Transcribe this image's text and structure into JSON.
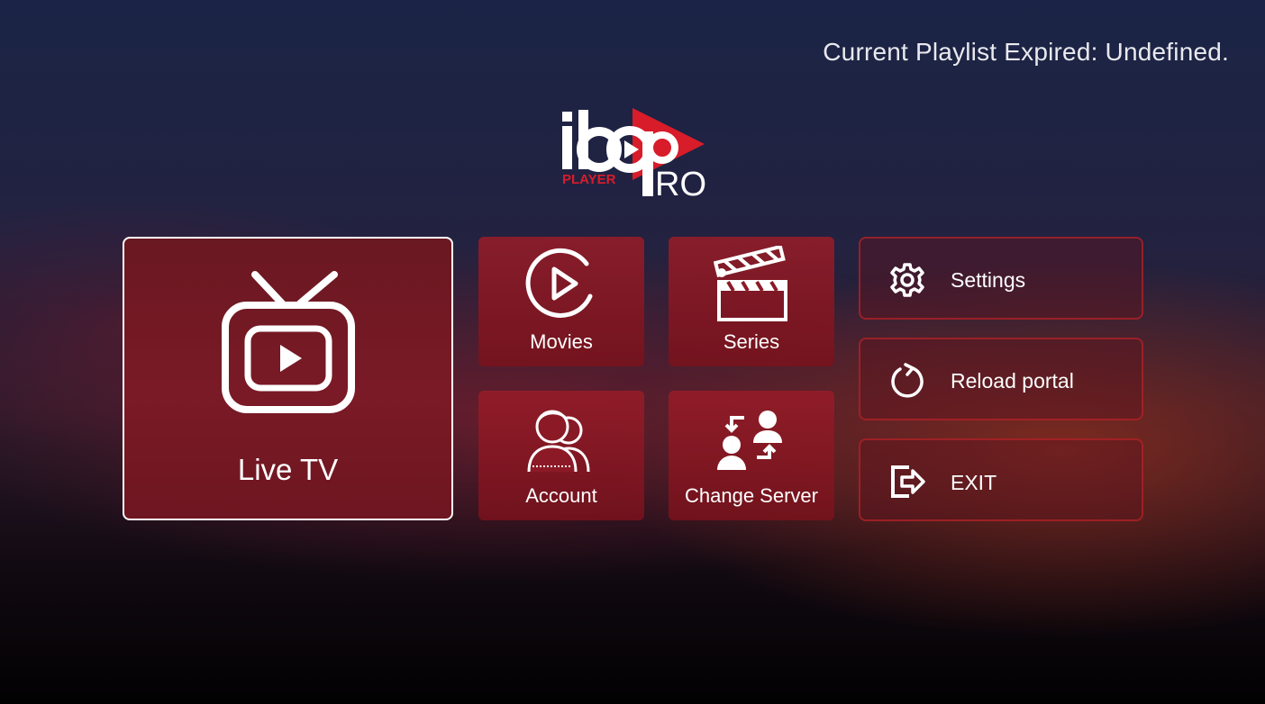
{
  "status": {
    "playlist_text": "Current Playlist Expired: Undefined."
  },
  "logo": {
    "brand_main": "ibo",
    "brand_sub": "PLAYER",
    "brand_pro": "PRO"
  },
  "tiles": {
    "live_tv": {
      "label": "Live TV",
      "icon": "tv-icon"
    },
    "movies": {
      "label": "Movies",
      "icon": "play-circle-icon"
    },
    "series": {
      "label": "Series",
      "icon": "clapperboard-icon"
    },
    "account": {
      "label": "Account",
      "icon": "users-icon"
    },
    "change_server": {
      "label": "Change Server",
      "icon": "swap-users-icon"
    }
  },
  "menu": {
    "settings": {
      "label": "Settings",
      "icon": "gear-icon"
    },
    "reload": {
      "label": "Reload portal",
      "icon": "reload-icon"
    },
    "exit": {
      "label": "EXIT",
      "icon": "exit-icon"
    }
  },
  "colors": {
    "accent": "#b3202c",
    "tile_bg": "#8c1a26",
    "text": "#ffffff"
  }
}
